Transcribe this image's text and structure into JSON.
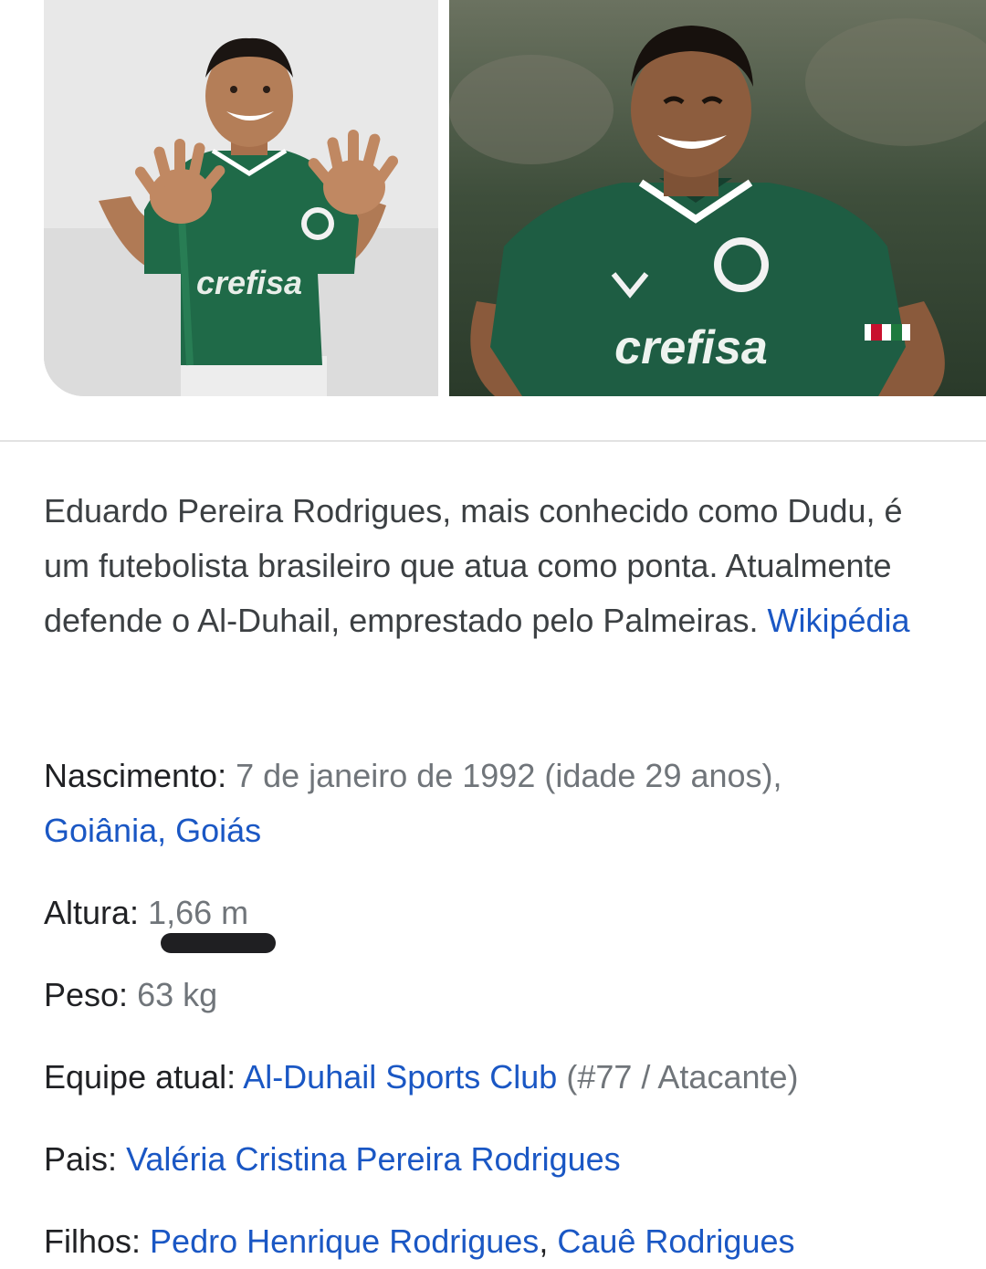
{
  "images": [
    {
      "alt": "Dudu posing in Palmeiras jersey",
      "jersey_text": "crefisa"
    },
    {
      "alt": "Dudu smiling in Palmeiras jersey",
      "jersey_text": "crefisa"
    }
  ],
  "description": {
    "text": "Eduardo Pereira Rodrigues, mais conhecido como Dudu, é um futebolista brasileiro que atua como ponta. Atualmente defende o Al-Duhail, emprestado pelo Palmeiras. ",
    "source_link": "Wikipédia"
  },
  "facts": {
    "nascimento": {
      "label": "Nascimento:",
      "value": " 7 de janeiro de 1992 (idade 29 anos),",
      "place_link": "Goiânia, Goiás"
    },
    "altura": {
      "label": "Altura:",
      "value": " 1,66 m"
    },
    "peso": {
      "label": "Peso:",
      "value": " 63 kg"
    },
    "equipe": {
      "label": "Equipe atual:",
      "team_link": "Al-Duhail Sports Club",
      "suffix": " (#77 / Atacante)"
    },
    "pais": {
      "label": "Pais:",
      "parent_link": "Valéria Cristina Pereira Rodrigues"
    },
    "filhos": {
      "label": "Filhos:",
      "child_1_link": "Pedro Henrique Rodrigues",
      "separator": ", ",
      "child_2_link": "Cauê Rodrigues"
    }
  },
  "colors": {
    "link": "#1a57c4",
    "label": "#202124",
    "value": "#70757a",
    "description": "#3c4043",
    "jersey_green": "#1f6a48"
  }
}
